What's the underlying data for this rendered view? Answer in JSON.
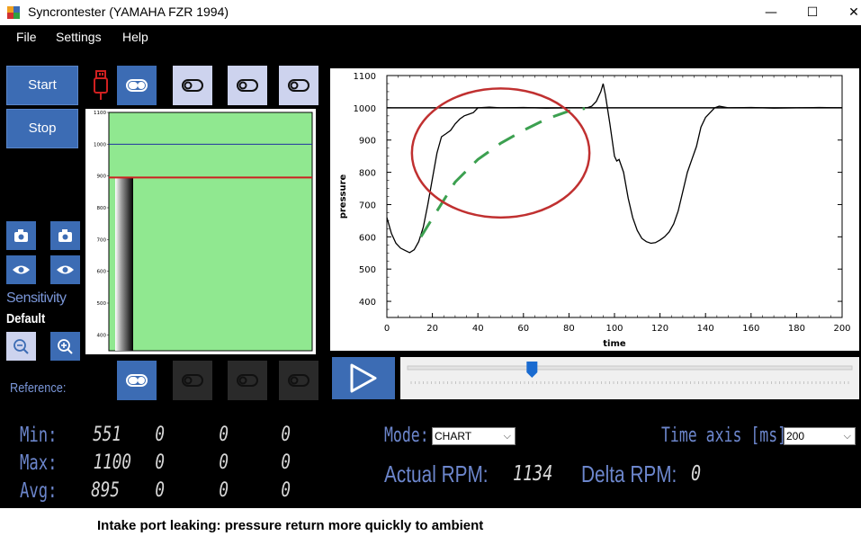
{
  "window": {
    "title": "Syncrontester (YAMAHA FZR 1994)",
    "minimize_glyph": "—",
    "maximize_glyph": "☐",
    "close_glyph": "✕"
  },
  "menu": [
    "File",
    "Settings",
    "Help"
  ],
  "controls": {
    "start_label": "Start",
    "stop_label": "Stop",
    "sensitivity_label": "Sensitivity",
    "sensitivity_value": "Default",
    "reference_label": "Reference:",
    "usb_icon": "usb-plug-icon",
    "camera_icon": "camera-icon",
    "eye_icon": "eye-icon",
    "zoom_out_icon": "zoom-out-icon",
    "zoom_in_icon": "zoom-in-icon",
    "toggle_icon": "toggle-icon",
    "play_icon": "play-icon"
  },
  "channel_toggles": [
    {
      "state": "on",
      "enabled": true
    },
    {
      "state": "off",
      "enabled": true
    },
    {
      "state": "off",
      "enabled": true
    },
    {
      "state": "off",
      "enabled": true
    }
  ],
  "reference_toggles": [
    {
      "state": "on",
      "enabled": true
    },
    {
      "state": "off",
      "enabled": false
    },
    {
      "state": "off",
      "enabled": false
    },
    {
      "state": "off",
      "enabled": false
    }
  ],
  "colors": {
    "accent": "#3c6cb4",
    "label_blue": "#6c86cc",
    "gauge_green": "#90e890",
    "limit_red": "#cc2020",
    "ref_blue": "#2030a0",
    "trace_green": "#3ca050",
    "circle_red": "#c03030"
  },
  "bar_gauge": {
    "min": 350,
    "max": 1100,
    "ticks": [
      1100,
      1000,
      900,
      800,
      700,
      600,
      500,
      400
    ],
    "blue_line": 1000,
    "red_line": 895,
    "bar_top": 895
  },
  "chart_data": {
    "type": "line",
    "xlabel": "time",
    "ylabel": "pressure",
    "xlim": [
      0,
      200
    ],
    "ylim": [
      350,
      1100
    ],
    "xticks": [
      0,
      20,
      40,
      60,
      80,
      100,
      120,
      140,
      160,
      180,
      200
    ],
    "yticks": [
      400,
      500,
      600,
      700,
      800,
      900,
      1000,
      1100
    ],
    "reference_line": 1000,
    "series": [
      {
        "style": "solid-black",
        "x": [
          0,
          2,
          4,
          6,
          8,
          10,
          12,
          14,
          16,
          18,
          20,
          22,
          24,
          26,
          28,
          30,
          32,
          34,
          36,
          38,
          40,
          45,
          50,
          60,
          70,
          80,
          88,
          90,
          92,
          94,
          95,
          96,
          98,
          100,
          101,
          102,
          104,
          106,
          108,
          110,
          112,
          114,
          116,
          118,
          120,
          122,
          124,
          126,
          128,
          130,
          132,
          134,
          136,
          138,
          140,
          142,
          144,
          146,
          150,
          160,
          170,
          180,
          190,
          200
        ],
        "y": [
          660,
          610,
          580,
          565,
          558,
          551,
          560,
          585,
          630,
          700,
          780,
          860,
          910,
          920,
          930,
          950,
          965,
          975,
          980,
          985,
          1000,
          1002,
          1000,
          1001,
          999,
          1000,
          1000,
          1005,
          1020,
          1050,
          1075,
          1040,
          950,
          850,
          835,
          840,
          800,
          720,
          660,
          620,
          595,
          585,
          580,
          582,
          590,
          600,
          615,
          640,
          680,
          740,
          800,
          840,
          880,
          940,
          970,
          985,
          1000,
          1005,
          1000,
          1001,
          999,
          1000,
          1001,
          1000
        ]
      },
      {
        "style": "dashed-green",
        "x": [
          15,
          22,
          30,
          40,
          50,
          60,
          70,
          80,
          87
        ],
        "y": [
          600,
          680,
          770,
          840,
          890,
          930,
          965,
          990,
          998
        ]
      }
    ],
    "annotation_circle": {
      "cx": 50,
      "cy": 860,
      "rx": 39,
      "ry": 200
    }
  },
  "playback": {
    "slider_value": 0.28
  },
  "stats": {
    "min_label": "Min:",
    "max_label": "Max:",
    "avg_label": "Avg:",
    "min": [
      "551",
      "0",
      "0",
      "0"
    ],
    "max": [
      "1100",
      "0",
      "0",
      "0"
    ],
    "avg": [
      "895",
      "0",
      "0",
      "0"
    ]
  },
  "mode": {
    "label": "Mode:",
    "value": "CHART",
    "chevron": "⌵"
  },
  "time_axis": {
    "label": "Time axis [ms]:",
    "value": "200",
    "chevron": "⌵"
  },
  "rpm": {
    "actual_label": "Actual RPM:",
    "actual_value": "1134",
    "delta_label": "Delta RPM:",
    "delta_value": "0"
  },
  "caption": "Intake port leaking: pressure return more quickly to ambient"
}
